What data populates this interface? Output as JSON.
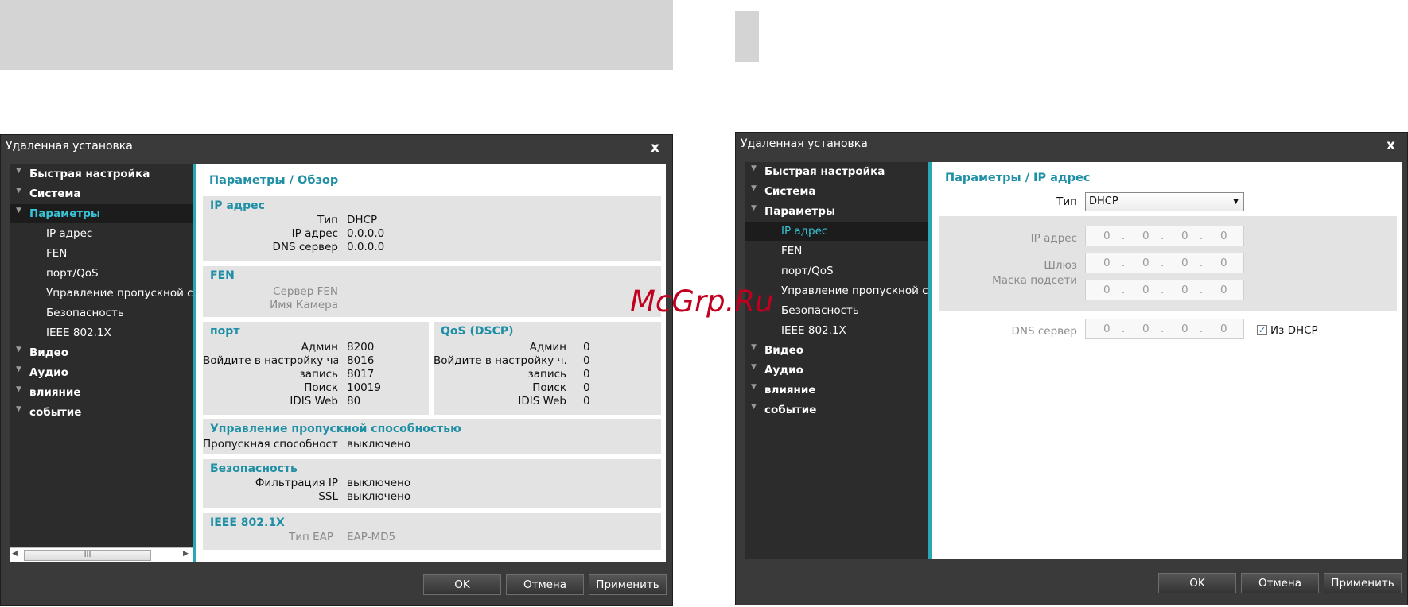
{
  "watermark": "McGrp.Ru",
  "dialog_left": {
    "title": "Удаленная установка",
    "close": "x",
    "nav": {
      "quick": "Быстрая настройка",
      "system": "Система",
      "params": "Параметры",
      "ip": "IP адрес",
      "fen": "FEN",
      "port_qos": "порт/QoS",
      "bandwidth": "Управление пропускной способностью",
      "security": "Безопасность",
      "ieee": "IEEE 802.1X",
      "video": "Видео",
      "audio": "Аудио",
      "influence": "влияние",
      "event": "событие"
    },
    "scroll_thumb": "III",
    "page_title": "Параметры / Обзор",
    "ip": {
      "title": "IP адрес",
      "type_label": "Тип",
      "type_value": "DHCP",
      "addr_label": "IP адрес",
      "addr_value": "0.0.0.0",
      "dns_label": "DNS сервер",
      "dns_value": "0.0.0.0"
    },
    "fen": {
      "title": "FEN",
      "server_label": "Сервер FEN",
      "camera_label": "Имя Камера"
    },
    "port": {
      "title": "порт",
      "admin_label": "Админ",
      "admin_value": "8200",
      "watch_label": "Войдите в настройку ча...",
      "watch_value": "8016",
      "record_label": "запись",
      "record_value": "8017",
      "search_label": "Поиск",
      "search_value": "10019",
      "web_label": "IDIS Web",
      "web_value": "80"
    },
    "qos": {
      "title": "QoS (DSCP)",
      "admin_label": "Админ",
      "admin_value": "0",
      "watch_label": "Войдите в настройку ч...",
      "watch_value": "0",
      "record_label": "запись",
      "record_value": "0",
      "search_label": "Поиск",
      "search_value": "0",
      "web_label": "IDIS Web",
      "web_value": "0"
    },
    "bandwidth": {
      "title": "Управление пропускной способностью",
      "label": "Пропускная способность",
      "value": "выключено"
    },
    "security": {
      "title": "Безопасность",
      "ipfilter_label": "Фильтрация IP",
      "ipfilter_value": "выключено",
      "ssl_label": "SSL",
      "ssl_value": "выключено"
    },
    "ieee": {
      "title": "IEEE 802.1X",
      "eap_label": "Тип EAP",
      "eap_value": "EAP-MD5"
    },
    "buttons": {
      "ok": "OK",
      "cancel": "Отмена",
      "apply": "Применить"
    }
  },
  "dialog_right": {
    "title": "Удаленная установка",
    "close": "x",
    "page_title": "Параметры / IP адрес",
    "type_label": "Тип",
    "type_value": "DHCP",
    "ip_label": "IP адрес",
    "gateway_label": "Шлюз",
    "mask_label": "Маска подсети",
    "dns_label": "DNS сервер",
    "octet": "0",
    "dot": ".",
    "from_dhcp_label": "Из DHCP",
    "from_dhcp_checked": true,
    "check_mark": "✓"
  }
}
